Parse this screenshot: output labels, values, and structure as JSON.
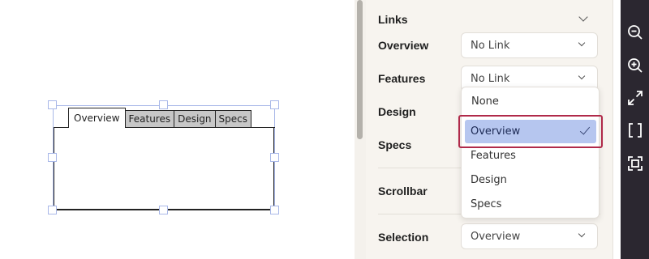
{
  "canvas": {
    "tabs": [
      {
        "label": "Overview",
        "active": true
      },
      {
        "label": "Features",
        "active": false
      },
      {
        "label": "Design",
        "active": false
      },
      {
        "label": "Specs",
        "active": false
      }
    ]
  },
  "panel": {
    "links_heading": "Links",
    "rows": {
      "overview": {
        "label": "Overview",
        "value": "No Link"
      },
      "features": {
        "label": "Features",
        "value": "No Link"
      },
      "design": {
        "label": "Design"
      },
      "specs": {
        "label": "Specs"
      },
      "scrollbar": {
        "label": "Scrollbar"
      },
      "selection": {
        "label": "Selection",
        "value": "Overview"
      }
    },
    "dropdown": {
      "options": [
        "None",
        "Overview",
        "Features",
        "Design",
        "Specs"
      ],
      "selected": "Overview"
    }
  },
  "toolbar": {
    "tools": [
      "zoom-out-icon",
      "zoom-in-icon",
      "expand-icon",
      "brackets-icon",
      "fit-frame-icon"
    ]
  },
  "colors": {
    "selection_highlight": "#b6c6ef",
    "focus_ring": "#b02a4a",
    "toolbar_bg": "#2b2730",
    "panel_bg": "#f7f4ef"
  }
}
